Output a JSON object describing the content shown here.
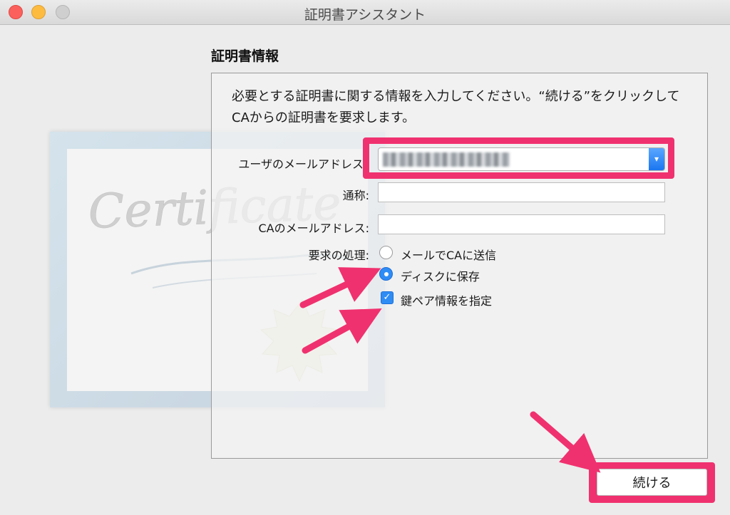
{
  "window": {
    "title": "証明書アシスタント"
  },
  "section": {
    "title": "証明書情報"
  },
  "description": "必要とする証明書に関する情報を入力してください。“続ける”をクリックしてCAからの証明書を要求します。",
  "form": {
    "user_email_label": "ユーザのメールアドレス",
    "user_email_value": "",
    "common_name_label": "通称:",
    "common_name_value": "",
    "ca_email_label": "CAのメールアドレス:",
    "ca_email_value": "",
    "request_label": "要求の処理:",
    "options": {
      "email_ca": "メールでCAに送信",
      "save_disk": "ディスクに保存",
      "key_pair": "鍵ペア情報を指定"
    },
    "selected_option": "save_disk",
    "key_pair_checked": true
  },
  "buttons": {
    "continue": "続ける"
  },
  "artwork": {
    "certificate_script": "Certificate"
  },
  "colors": {
    "accent": "#2f8cf5",
    "highlight": "#f0316f"
  },
  "icons": {
    "select_arrow": "chevron-down-icon",
    "check": "checkmark-icon"
  }
}
